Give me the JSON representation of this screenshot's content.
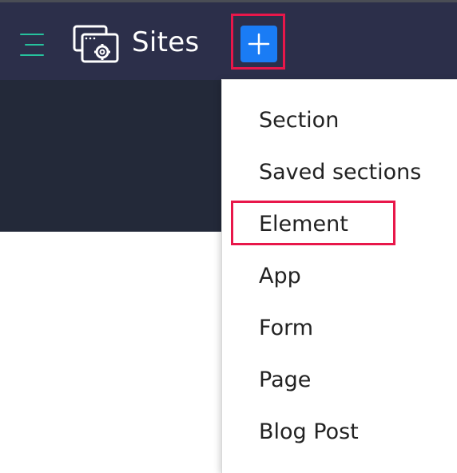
{
  "header": {
    "menu_icon": "hamburger-menu-icon",
    "logo_icon": "sites-logo-icon",
    "title": "Sites",
    "add_icon": "plus-icon",
    "colors": {
      "header_bg": "#2c2f4a",
      "subbar_bg": "#232939",
      "accent_green": "#26c29d",
      "add_button_blue": "#1a7cf5",
      "highlight_red": "#e8174a"
    }
  },
  "add_menu": {
    "items": [
      {
        "label": "Section"
      },
      {
        "label": "Saved sections"
      },
      {
        "label": "Element"
      },
      {
        "label": "App"
      },
      {
        "label": "Form"
      },
      {
        "label": "Page"
      },
      {
        "label": "Blog Post"
      }
    ]
  }
}
